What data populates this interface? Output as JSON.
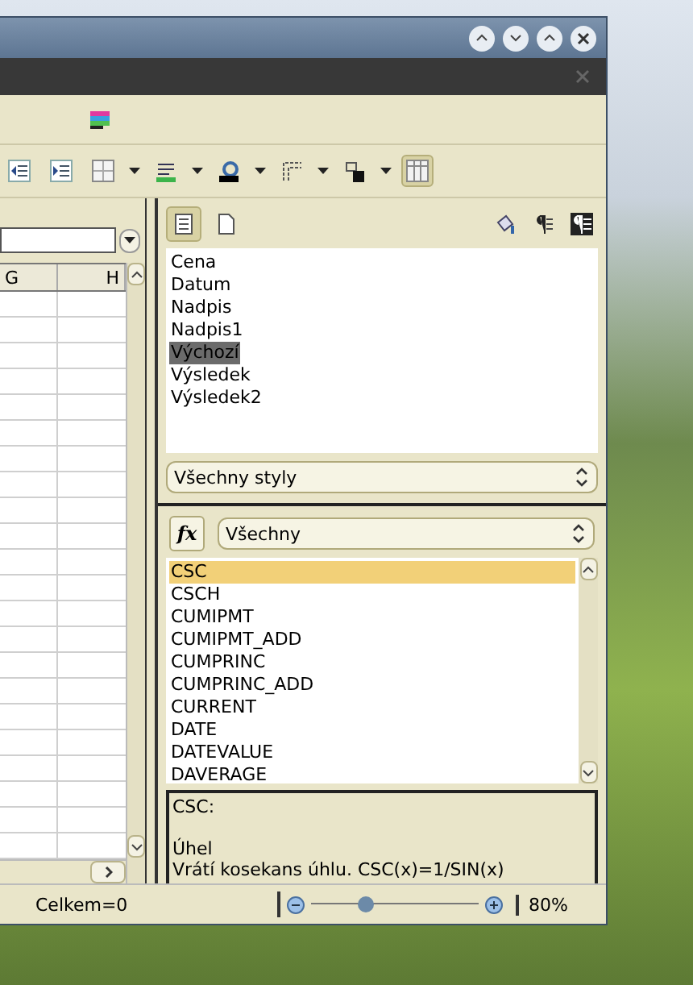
{
  "sheet": {
    "columns": [
      "G",
      "H"
    ]
  },
  "style_categories": [
    {
      "selected": true
    },
    {
      "selected": false
    }
  ],
  "styles": [
    {
      "label": "Cena",
      "selected": false
    },
    {
      "label": "Datum",
      "selected": false
    },
    {
      "label": "Nadpis",
      "selected": false
    },
    {
      "label": "Nadpis1",
      "selected": false
    },
    {
      "label": "Výchozí",
      "selected": true
    },
    {
      "label": "Výsledek",
      "selected": false
    },
    {
      "label": "Výsledek2",
      "selected": false
    }
  ],
  "style_filter": "Všechny styly",
  "function_category": "Všechny",
  "functions": [
    {
      "label": "CSC",
      "selected": true
    },
    {
      "label": "CSCH",
      "selected": false
    },
    {
      "label": "CUMIPMT",
      "selected": false
    },
    {
      "label": "CUMIPMT_ADD",
      "selected": false
    },
    {
      "label": "CUMPRINC",
      "selected": false
    },
    {
      "label": "CUMPRINC_ADD",
      "selected": false
    },
    {
      "label": "CURRENT",
      "selected": false
    },
    {
      "label": "DATE",
      "selected": false
    },
    {
      "label": "DATEVALUE",
      "selected": false
    },
    {
      "label": "DAVERAGE",
      "selected": false
    }
  ],
  "function_button": "fx",
  "description": {
    "name": "CSC:",
    "argument": "Úhel",
    "text": "Vrátí kosekans úhlu. CSC(x)=1/SIN(x)"
  },
  "status_bar": {
    "sum": "Celkem=0",
    "zoom": {
      "level": 0.33,
      "reading": "80%"
    }
  }
}
